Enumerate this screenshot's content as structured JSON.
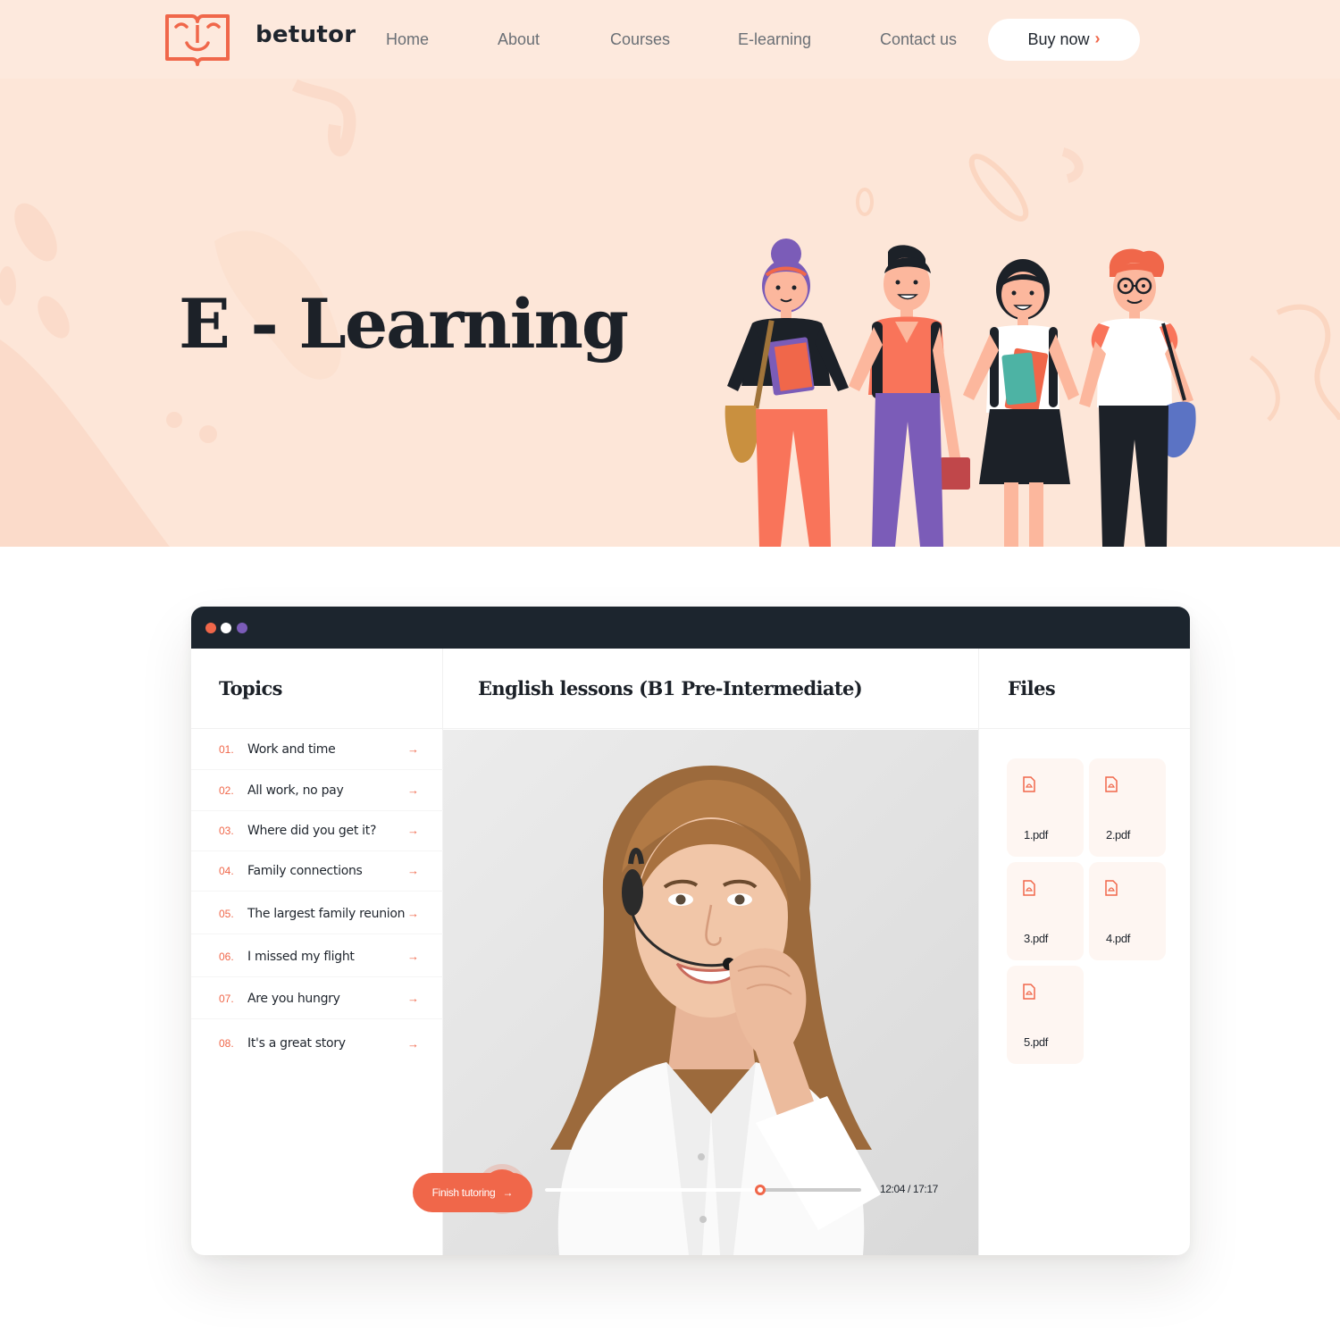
{
  "brand": {
    "name": "betutor",
    "logo_icon": "open-book-face-icon",
    "accent_color": "#f0674a"
  },
  "nav": {
    "items": [
      "Home",
      "About",
      "Courses",
      "E-learning",
      "Contact us"
    ],
    "cta_label": "Buy now",
    "cta_icon": "chevron-right-icon"
  },
  "hero": {
    "title": "E - Learning",
    "illustration": "four-students-illustration",
    "background_color": "#fde6d8"
  },
  "app": {
    "window_dots": [
      "#f0674a",
      "#ffffff",
      "#7b5cb8"
    ],
    "topics_heading": "Topics",
    "lesson_heading": "English lessons (B1 Pre-Intermediate)",
    "files_heading": "Files",
    "topics": [
      {
        "num": "01.",
        "label": "Work and time"
      },
      {
        "num": "02.",
        "label": "All work, no pay"
      },
      {
        "num": "03.",
        "label": "Where did you get it?"
      },
      {
        "num": "04.",
        "label": "Family connections"
      },
      {
        "num": "05.",
        "label": "The largest family reunion"
      },
      {
        "num": "06.",
        "label": "I missed my flight"
      },
      {
        "num": "07.",
        "label": "Are you hungry"
      },
      {
        "num": "08.",
        "label": "It's a great story"
      }
    ],
    "video": {
      "time": "12:04 / 17:17",
      "progress": 0.68,
      "play_icon": "play-icon"
    },
    "files": [
      "1.pdf",
      "2.pdf",
      "3.pdf",
      "4.pdf",
      "5.pdf"
    ],
    "file_icon": "pdf-file-icon",
    "finish_label": "Finish tutoring"
  }
}
